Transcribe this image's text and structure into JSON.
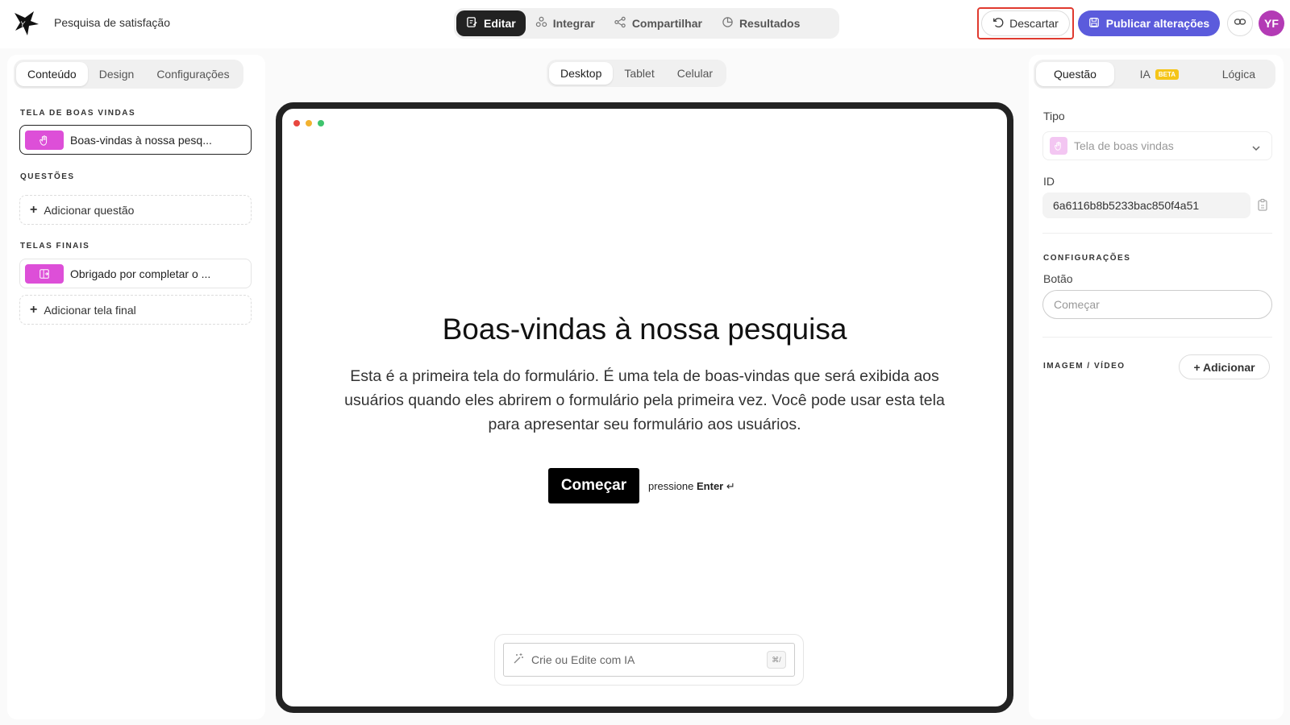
{
  "header": {
    "doc_title": "Pesquisa de satisfação",
    "nav": [
      {
        "label": "Editar",
        "icon": "edit-icon"
      },
      {
        "label": "Integrar",
        "icon": "integrate-icon"
      },
      {
        "label": "Compartilhar",
        "icon": "share-icon"
      },
      {
        "label": "Resultados",
        "icon": "results-icon"
      }
    ],
    "discard_label": "Descartar",
    "publish_label": "Publicar alterações",
    "avatar_initials": "YF"
  },
  "left": {
    "tabs": [
      "Conteúdo",
      "Design",
      "Configurações"
    ],
    "welcome_section": "TELA DE BOAS VINDAS",
    "welcome_item": "Boas-vindas à nossa pesq...",
    "questions_section": "QUESTÕES",
    "add_question": "Adicionar questão",
    "end_section": "TELAS FINAIS",
    "end_item": "Obrigado por completar o ...",
    "add_end_screen": "Adicionar tela final"
  },
  "center": {
    "device_tabs": [
      "Desktop",
      "Tablet",
      "Celular"
    ],
    "welcome_title": "Boas-vindas à nossa pesquisa",
    "welcome_desc": "Esta é a primeira tela do formulário. É uma tela de boas-vindas que será exibida aos usuários quando eles abrirem o formulário pela primeira vez. Você pode usar esta tela para apresentar seu formulário aos usuários.",
    "start_button": "Começar",
    "press_prefix": "pressione",
    "press_key": "Enter",
    "ai_placeholder": "Crie ou Edite com IA",
    "ai_shortcut": "⌘/"
  },
  "right": {
    "tabs": [
      "Questão",
      "IA",
      "Lógica"
    ],
    "beta": "BETA",
    "type_label": "Tipo",
    "type_value": "Tela de boas vindas",
    "id_label": "ID",
    "id_value": "6a6116b8b5233bac850f4a51",
    "settings_section": "CONFIGURAÇÕES",
    "button_label": "Botão",
    "button_placeholder": "Começar",
    "media_section": "IMAGEM / VÍDEO",
    "add_media": "+ Adicionar"
  },
  "colors": {
    "accent": "#5b5bdc",
    "discard_outline": "#e03a2f",
    "item_icon": "#dd4fd8",
    "avatar": "#b33bb5"
  }
}
